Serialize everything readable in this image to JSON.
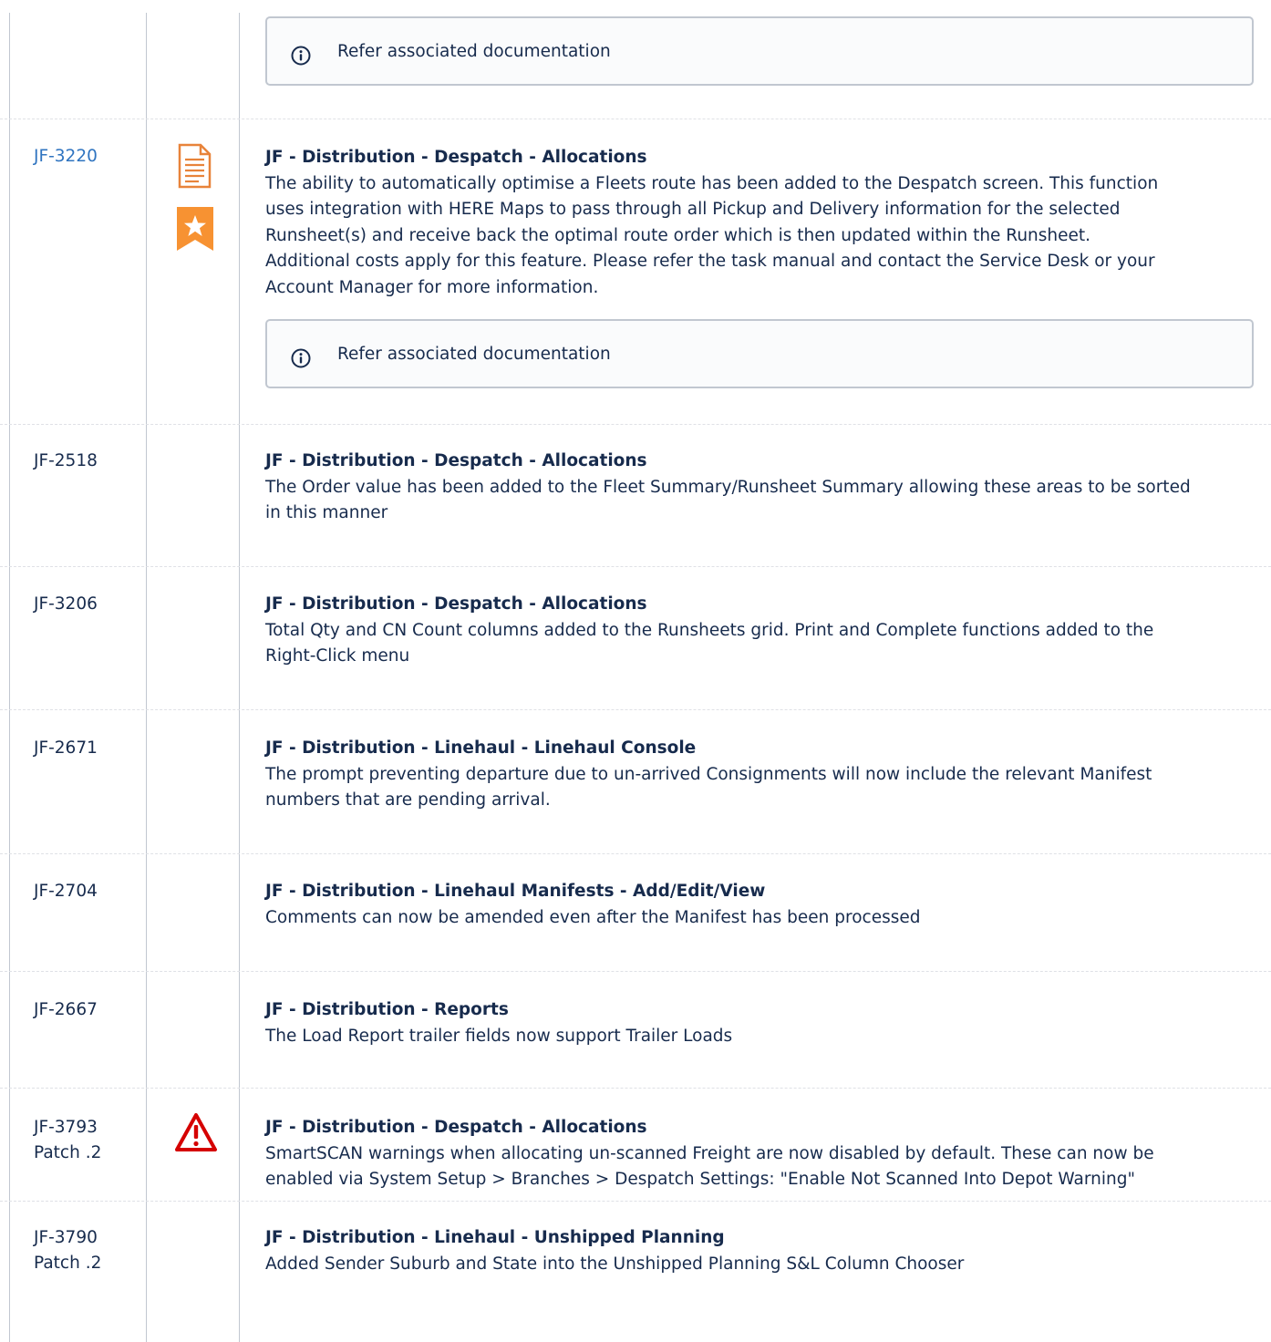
{
  "colors": {
    "link": "#2f74c0",
    "doc_icon": "#e8833a",
    "star_badge": "#f79232",
    "warning": "#d50000",
    "panel_border": "#c1c7d0"
  },
  "rows": [
    {
      "panel": {
        "icon": "info-icon",
        "text": "Refer associated documentation"
      }
    },
    {
      "key": "JF-3220",
      "icons": [
        "document-icon",
        "star-badge-icon"
      ],
      "title": "JF - Distribution - Despatch - Allocations",
      "lines": [
        "The ability to automatically optimise a Fleets route has been added to the Despatch screen.   This function",
        "uses integration with HERE Maps to pass through all Pickup and Delivery information for the selected",
        "Runsheet(s) and receive back the optimal route order which is then updated within the Runsheet.",
        "Additional costs apply for this feature.  Please refer the task manual and contact the Service Desk or your",
        "Account Manager for more information."
      ],
      "panel": {
        "icon": "info-icon",
        "text": "Refer associated documentation"
      }
    },
    {
      "key": "JF-2518",
      "title": "JF - Distribution - Despatch - Allocations",
      "lines": [
        "The Order value has been added to the Fleet Summary/Runsheet Summary allowing these areas to be sorted",
        "in this manner"
      ]
    },
    {
      "key": "JF-3206",
      "title": "JF - Distribution - Despatch - Allocations",
      "lines": [
        "Total Qty and CN Count columns added to the Runsheets grid.  Print and Complete functions added to the",
        "Right-Click menu"
      ]
    },
    {
      "key": "JF-2671",
      "title": "JF - Distribution - Linehaul - Linehaul Console",
      "lines": [
        "The prompt preventing departure due to un-arrived Consignments will now include the relevant Manifest",
        "numbers that are pending arrival."
      ]
    },
    {
      "key": "JF-2704",
      "title": "JF - Distribution - Linehaul Manifests - Add/Edit/View",
      "lines": [
        "Comments can now be amended even after the Manifest has been processed"
      ]
    },
    {
      "key": "JF-2667",
      "title": "JF - Distribution - Reports",
      "lines": [
        "The Load Report trailer fields now support Trailer Loads"
      ]
    },
    {
      "key": "JF-3793",
      "key2": "Patch .2",
      "icons": [
        "warning-icon"
      ],
      "title": "JF - Distribution - Despatch - Allocations",
      "lines": [
        "SmartSCAN warnings when allocating un-scanned Freight are now disabled by default.  These can now be",
        "enabled via System Setup > Branches > Despatch Settings: \"Enable Not Scanned Into Depot Warning\""
      ]
    },
    {
      "key": "JF-3790",
      "key2": "Patch .2",
      "title": "JF - Distribution - Linehaul - Unshipped Planning",
      "lines": [
        "Added Sender Suburb and State into the Unshipped Planning S&L Column Chooser"
      ]
    }
  ]
}
